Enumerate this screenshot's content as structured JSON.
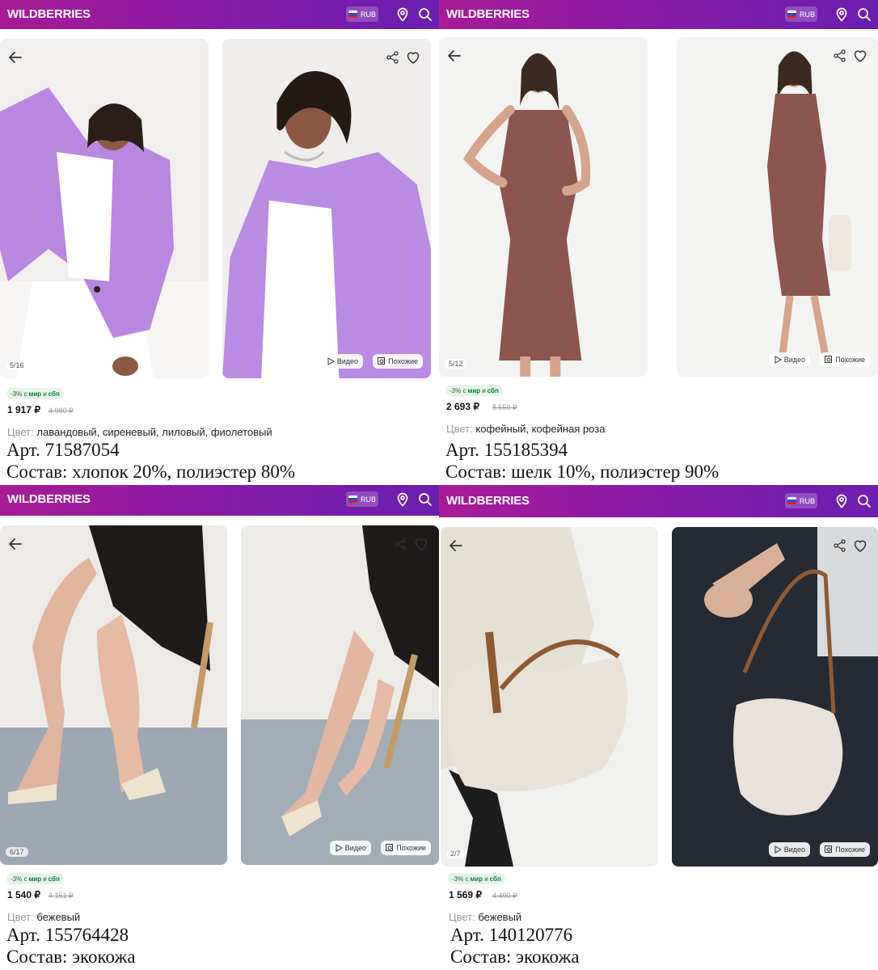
{
  "brand": "WILDBERRIES",
  "currency": "RUB",
  "flag_colors": [
    "#ffffff",
    "#1c4fc4",
    "#d8222a"
  ],
  "header_gradient": [
    "#a81c96",
    "#6a1fb0"
  ],
  "icons": {
    "back": "arrow-left-icon",
    "share": "share-icon",
    "favorite": "heart-icon",
    "location": "map-pin-icon",
    "search": "search-icon",
    "video": "play-icon",
    "similar": "similar-search-icon"
  },
  "pills": {
    "video": "Видео",
    "similar": "Похожие"
  },
  "promo": {
    "prefix": "-3% с",
    "mir": "мир",
    "and": "и",
    "sbp": "сбп"
  },
  "color_label": "Цвет:",
  "products": [
    {
      "counter": "5/16",
      "price": "1 917 ₽",
      "old_price": "4 980 ₽",
      "color": "лавандовый, сиреневый, лиловый, фиолетовый",
      "article": "Арт. 71587054",
      "composition": "Состав: хлопок 20%, полиэстер 80%"
    },
    {
      "counter": "5/12",
      "price": "2 693 ₽",
      "old_price": "8 550 ₽",
      "color": "кофейный, кофейная роза",
      "article": "Арт. 155185394",
      "composition": "Состав: шелк 10%, полиэстер 90%"
    },
    {
      "counter": "6/17",
      "price": "1 540 ₽",
      "old_price": "4 151 ₽",
      "color": "бежевый",
      "article": "Арт. 155764428",
      "composition": "Состав: экокожа"
    },
    {
      "counter": "2/7",
      "price": "1 569 ₽",
      "old_price": "4 490 ₽",
      "color": "бежевый",
      "article": "Арт. 140120776",
      "composition": "Состав: экокожа"
    }
  ]
}
